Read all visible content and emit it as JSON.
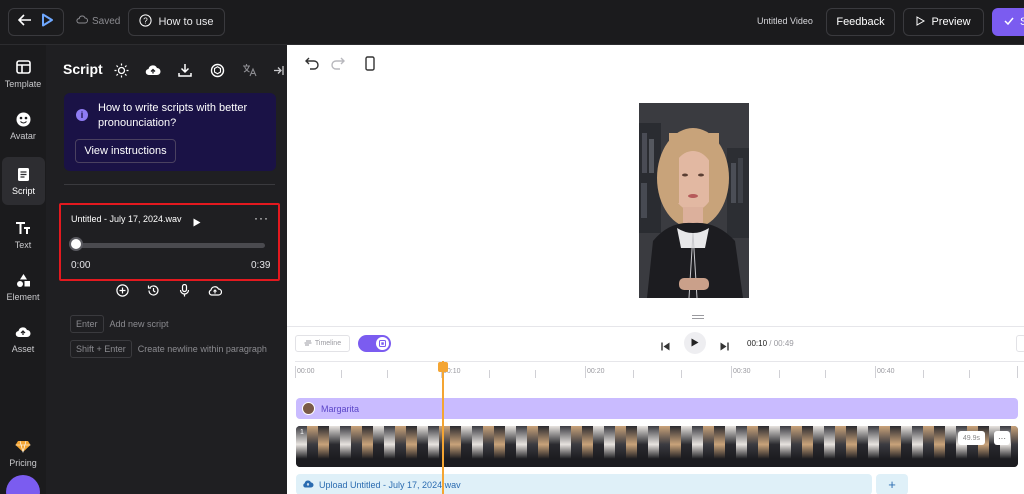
{
  "topbar": {
    "saved_label": "Saved",
    "how_to_use_label": "How to use",
    "video_title": "Untitled Video",
    "feedback_label": "Feedback",
    "preview_label": "Preview",
    "submit_label": "S"
  },
  "rail": {
    "items": [
      {
        "label": "Template",
        "icon": "template-icon"
      },
      {
        "label": "Avatar",
        "icon": "avatar-icon"
      },
      {
        "label": "Script",
        "icon": "script-icon"
      },
      {
        "label": "Text",
        "icon": "text-icon"
      },
      {
        "label": "Element",
        "icon": "element-icon"
      },
      {
        "label": "Asset",
        "icon": "asset-icon"
      },
      {
        "label": "Pricing",
        "icon": "pricing-icon"
      }
    ],
    "active": "Script"
  },
  "script_panel": {
    "title": "Script",
    "info_text": "How to write scripts with better pronounciation?",
    "view_instructions_label": "View instructions",
    "audio": {
      "file_name": "Untitled - July 17, 2024.wav",
      "current_time": "0:00",
      "total_time": "0:39",
      "progress": 0
    },
    "shortcuts": [
      {
        "key": "Enter",
        "description": "Add new script"
      },
      {
        "key": "Shift + Enter",
        "description": "Create newline within paragraph"
      }
    ]
  },
  "timeline": {
    "mode_label": "Timeline",
    "current_time": "00:10",
    "separator": " / ",
    "total_time": "00:49",
    "ruler_ticks": [
      "00:00",
      "00:10",
      "00:20",
      "00:30",
      "00:40"
    ],
    "avatar_track_label": "Margarita",
    "video_track_index": "1",
    "video_duration": "49.9s",
    "upload_track_label": "Upload Untitled - July 17, 2024.wav",
    "add_label": "+"
  },
  "colors": {
    "accent": "#7b5cf0",
    "highlight_border": "#e3191f",
    "playhead": "#f4a533",
    "avatar_track": "#c9bbff",
    "upload_track": "#dff0f8"
  }
}
